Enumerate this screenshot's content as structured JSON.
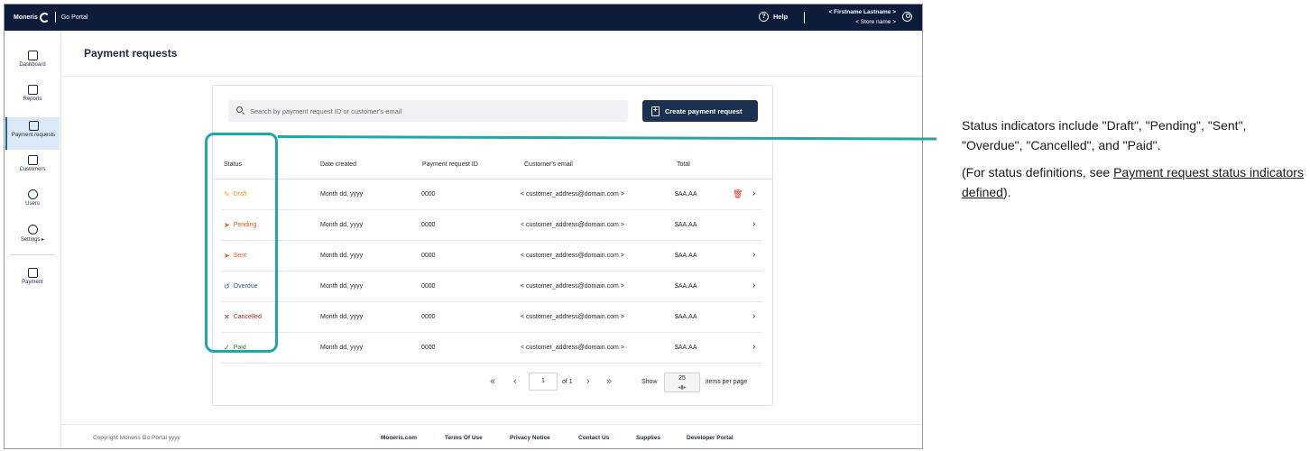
{
  "topbar": {
    "logo_brand": "Moneris",
    "logo_product": "Go Portal",
    "help_label": "Help",
    "user_name": "< Firstname Lastname >",
    "store_name": "< Store name >"
  },
  "sidebar": {
    "items": [
      {
        "label": "Dashboard",
        "icon": "dashboard-icon"
      },
      {
        "label": "Reports",
        "icon": "reports-icon"
      },
      {
        "label": "Payment requests",
        "icon": "payment-requests-icon"
      },
      {
        "label": "Customers",
        "icon": "customers-icon"
      },
      {
        "label": "Users",
        "icon": "users-icon"
      },
      {
        "label": "Settings ▸",
        "icon": "gear-icon"
      },
      {
        "label": "Payment",
        "icon": "payment-icon"
      }
    ]
  },
  "page": {
    "title": "Payment requests"
  },
  "search": {
    "placeholder": "Search by payment request ID or customer's email"
  },
  "create_button": "Create payment request",
  "table": {
    "headers": [
      "Status",
      "Date created",
      "Payment request ID",
      "Customer's email",
      "Total"
    ],
    "rows": [
      {
        "status": "Draft",
        "glyph": "✎",
        "color": "#f0a020",
        "date": "Month  dd, yyyy",
        "id": "0000",
        "email": "< customer_address@domain.com >",
        "total": "$AA.AA",
        "delete": true
      },
      {
        "status": "Pending",
        "glyph": "➤",
        "color": "#e8581c",
        "date": "Month  dd, yyyy",
        "id": "0000",
        "email": "< customer_address@domain.com >",
        "total": "$AA.AA",
        "delete": false
      },
      {
        "status": "Sent",
        "glyph": "➤",
        "color": "#e8581c",
        "date": "Month  dd, yyyy",
        "id": "0000",
        "email": "< customer_address@domain.com >",
        "total": "$AA.AA",
        "delete": false
      },
      {
        "status": "Overdue",
        "glyph": "↺",
        "color": "#2a5fa8",
        "date": "Month  dd, yyyy",
        "id": "0000",
        "email": "< customer_address@domain.com >",
        "total": "$AA.AA",
        "delete": false
      },
      {
        "status": "Cancelled",
        "glyph": "✕",
        "color": "#b3261e",
        "date": "Month  dd, yyyy",
        "id": "0000",
        "email": "< customer_address@domain.com >",
        "total": "$AA.AA",
        "delete": false
      },
      {
        "status": "Paid",
        "glyph": "✓",
        "color": "#2e7d32",
        "date": "Month  dd, yyyy",
        "id": "0000",
        "email": "< customer_address@domain.com >",
        "total": "$AA.AA",
        "delete": false
      }
    ]
  },
  "pager": {
    "page": "1",
    "of_label": "of 1",
    "show_label": "Show",
    "per_page": "25",
    "per_page_label": "items per page"
  },
  "footer": {
    "copyright": "Copyright Moneris Go Portal  yyyy",
    "links": [
      "Moneris.com",
      "Terms Of Use",
      "Privacy Notice",
      "Contact Us",
      "Supplies",
      "Developer Portal"
    ]
  },
  "annotation": {
    "line1": "Status indicators include \"Draft\", \"Pending\", \"Sent\", \"Overdue\", \"Cancelled\", and \"Paid\".",
    "line2_prefix": "(For status definitions, see ",
    "line2_link": "Payment request status indicators defined",
    "line2_suffix": ")."
  },
  "colors": {
    "topbar": "#0c1c3a",
    "highlight": "#1fa8a8",
    "primary_button": "#1b3152"
  }
}
